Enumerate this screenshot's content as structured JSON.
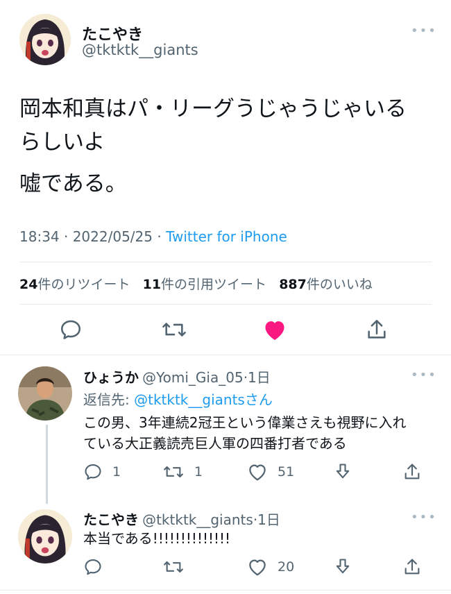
{
  "tweet": {
    "author_name": "たこやき",
    "author_handle": "@tktktk__giants",
    "text_line1": "岡本和真はパ・リーグうじゃうじゃいる",
    "text_line2": "らしいよ",
    "text_line3": "嘘である。",
    "time": "18:34 · 2022/05/25 · ",
    "client": "Twitter for iPhone",
    "retweets_count": "24",
    "retweets_label": "件のリツイート",
    "quotes_count": "11",
    "quotes_label": "件の引用ツイート",
    "likes_count": "887",
    "likes_label": "件のいいね",
    "more": "•••"
  },
  "replies": [
    {
      "name": "ひょうか",
      "handle": "@Yomi_Gia_05",
      "time": "·1日",
      "reply_to_prefix": "返信先: ",
      "reply_to_handle": "@tktktk__giants",
      "reply_to_suffix": "さん",
      "text_line1": "この男、3年連続2冠王という偉業さえも視野に入れ",
      "text_line2": "ている大正義読売巨人軍の四番打者である",
      "reply_count": "1",
      "retweet_count": "1",
      "like_count": "51",
      "more": "•••"
    },
    {
      "name": "たこやき",
      "handle": "@tktktk__giants",
      "time": "·1日",
      "text_line1": "本当である!!!!!!!!!!!!!!",
      "reply_count": "",
      "retweet_count": "",
      "like_count": "20",
      "more": "•••"
    }
  ],
  "colors": {
    "text": "#0f1419",
    "muted": "#536471",
    "link": "#1d9bf0",
    "like": "#f91880",
    "divider": "#e6ecf0"
  }
}
